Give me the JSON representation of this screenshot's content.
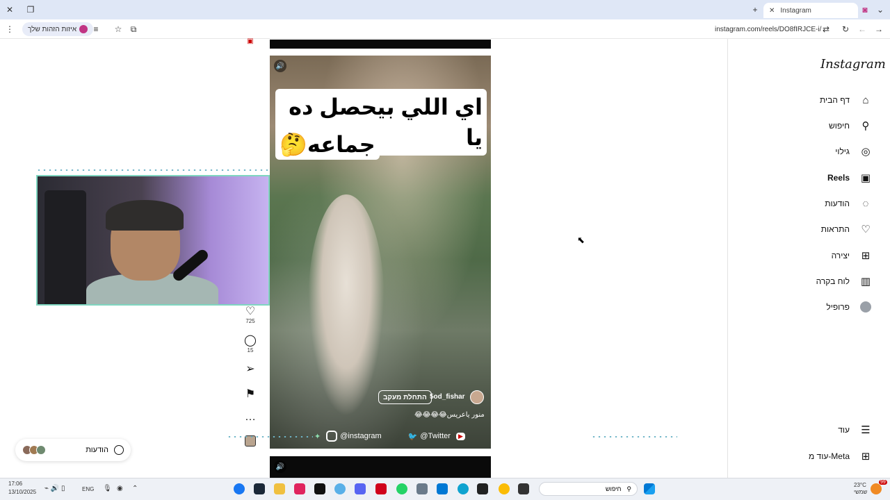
{
  "browser": {
    "tab_title": "Instagram",
    "url": "instagram.com/reels/DO8fIRJCE-i/",
    "profile_pill": "איזות הזהות שלך",
    "accent": "#dfe7f6"
  },
  "instagram": {
    "logo": "Instagram",
    "nav": [
      {
        "label": "דף הבית",
        "icon": "home-icon",
        "glyph": "⌂"
      },
      {
        "label": "חיפוש",
        "icon": "search-icon",
        "glyph": "⚲"
      },
      {
        "label": "גילוי",
        "icon": "compass-icon",
        "glyph": "◎"
      },
      {
        "label": "Reels",
        "icon": "reels-icon",
        "glyph": "▣"
      },
      {
        "label": "הודעות",
        "icon": "messenger-icon",
        "glyph": "◌"
      },
      {
        "label": "התראות",
        "icon": "heart-icon",
        "glyph": "♡"
      },
      {
        "label": "יצירה",
        "icon": "plus-square-icon",
        "glyph": "⊞"
      },
      {
        "label": "לוח בקרה",
        "icon": "dashboard-icon",
        "glyph": "▥"
      },
      {
        "label": "פרופיל",
        "icon": "profile-avatar-icon",
        "glyph": "●"
      }
    ],
    "more": {
      "label": "עוד",
      "icon": "hamburger-icon",
      "glyph": "☰"
    },
    "meta": {
      "label": "עוד מ-Meta",
      "icon": "grid-icon",
      "glyph": "⊞"
    }
  },
  "reel": {
    "caption_line1": "اي اللي بيحصل ده يا",
    "caption_line2": "جماعه🤔",
    "author": "5od_fishar",
    "follow_label": "התחלת מעקב",
    "description": "منور ياعريس😂😂😂😂",
    "likes": "725",
    "comments": "15"
  },
  "stream_bar": {
    "instagram": "@instagram",
    "twitter": "@Twitter",
    "youtube": "▶"
  },
  "messages_chip": {
    "label": "הודעות"
  },
  "taskbar": {
    "time": "17:06",
    "date": "13/10/2025",
    "lang": "ENG",
    "search_label": "חיפוש",
    "weather": "23°C",
    "weather_sub": "שמשי",
    "notif_count": "99"
  }
}
